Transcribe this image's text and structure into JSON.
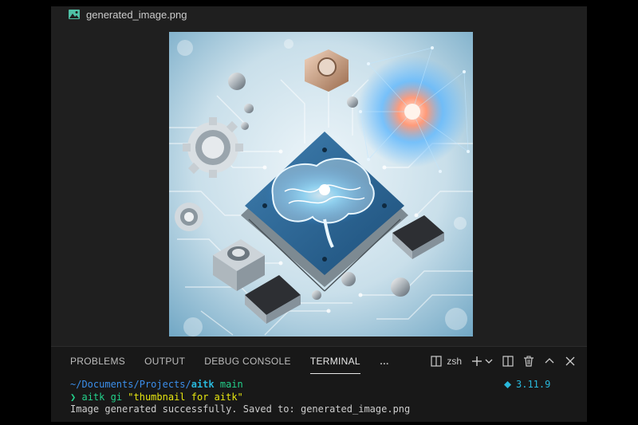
{
  "editor": {
    "tab_title": "generated_image.png",
    "image_alt": "generated_image.png"
  },
  "panel": {
    "tabs": [
      {
        "label": "PROBLEMS",
        "active": false
      },
      {
        "label": "OUTPUT",
        "active": false
      },
      {
        "label": "DEBUG CONSOLE",
        "active": false
      },
      {
        "label": "TERMINAL",
        "active": true
      }
    ],
    "more_label": "…",
    "shell_label": "zsh",
    "icons": [
      "split-terminal-icon",
      "terminal-icon",
      "add-terminal-icon",
      "chevron-down-icon",
      "split-panel-icon",
      "trash-icon",
      "maximize-panel-icon",
      "close-panel-icon"
    ]
  },
  "terminal": {
    "cwd_prefix": "~/Documents/Projects/",
    "cwd_repo": "aitk",
    "branch": "main",
    "prompt_symbol": "❯",
    "command": "aitk gi",
    "argument": "\"thumbnail for aitk\"",
    "output": "Image generated successfully. Saved to: generated_image.png",
    "python_version": "3.11.9"
  },
  "colors": {
    "window_bg": "#1f1f1f",
    "panel_bg": "#181818",
    "accent_cyan": "#29b8db",
    "accent_green": "#23d18b",
    "string_yellow": "#e5e510"
  }
}
